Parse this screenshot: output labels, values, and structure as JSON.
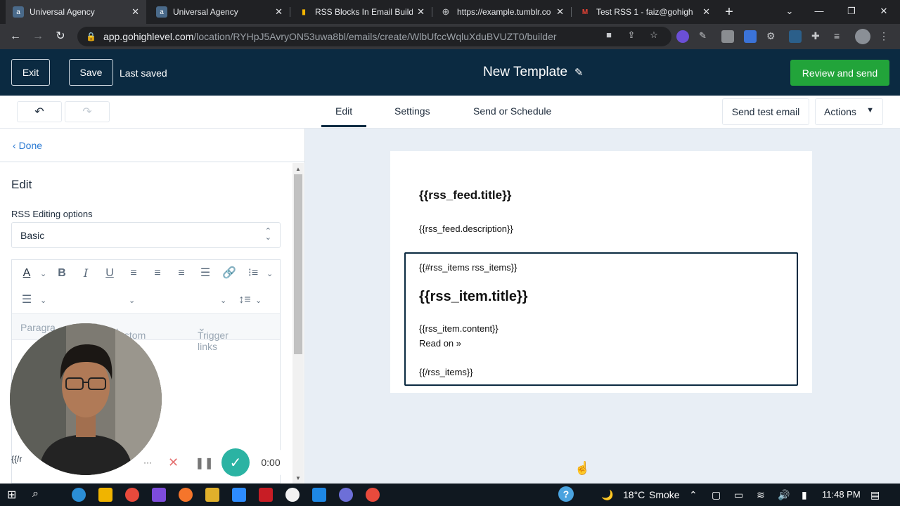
{
  "browser": {
    "tabs": [
      {
        "title": "Universal Agency",
        "active": true
      },
      {
        "title": "Universal Agency",
        "active": false
      },
      {
        "title": "RSS Blocks In Email Builde",
        "active": false
      },
      {
        "title": "https://example.tumblr.co",
        "active": false
      },
      {
        "title": "Test RSS 1 - faiz@gohigh",
        "active": false
      }
    ],
    "url_host": "app.gohighlevel.com",
    "url_path": "/location/RYHpJ5AvryON53uwa8bl/emails/create/WlbUfccWqluXduBVUZT0/builder"
  },
  "header": {
    "exit_label": "Exit",
    "save_label": "Save",
    "last_saved": "Last saved",
    "template_title": "New Template",
    "review_label": "Review and send",
    "accent_color": "#22a43a"
  },
  "subbar": {
    "tabs": [
      "Edit",
      "Settings",
      "Send or Schedule"
    ],
    "active_tab": "Edit",
    "send_test_label": "Send test email",
    "actions_label": "Actions"
  },
  "panel": {
    "done_label": "Done",
    "heading": "Edit",
    "rss_options_label": "RSS Editing options",
    "rss_option_value": "Basic",
    "row3": {
      "paragraph": "Paragra",
      "custom_values": "Custom values",
      "trigger_links": "Trigger links"
    },
    "snippet": "{{/r"
  },
  "email": {
    "feed_title": "{{rss_feed.title}}",
    "feed_description": "{{rss_feed.description}}",
    "items_open": "{{#rss_items rss_items}}",
    "item_title": "{{rss_item.title}}",
    "item_content": "{{rss_item.content}}",
    "read_on": "Read on »",
    "items_close": "{{/rss_items}}"
  },
  "recorder": {
    "timer": "0:00"
  },
  "taskbar": {
    "weather_temp": "18°C",
    "weather_text": "Smoke",
    "time": "11:48 PM"
  }
}
